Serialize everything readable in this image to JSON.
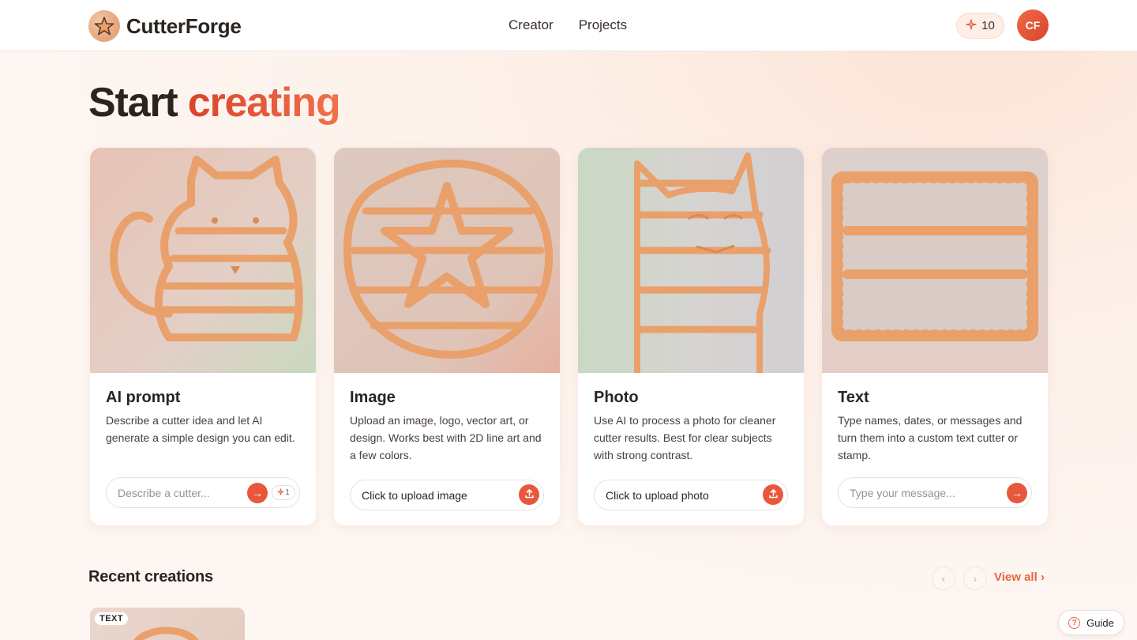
{
  "app": {
    "name": "CutterForge"
  },
  "nav": {
    "items": [
      "Creator",
      "Projects"
    ]
  },
  "header": {
    "credits": "10",
    "avatar_initials": "CF"
  },
  "hero": {
    "title_plain": "Start",
    "title_accent": "creating"
  },
  "cards": [
    {
      "title": "AI prompt",
      "description": "Describe a cutter idea and let AI generate a simple design you can edit.",
      "input_placeholder": "Describe a cutter...",
      "cost": "1",
      "image": "cat-cookie-cutter"
    },
    {
      "title": "Image",
      "description": "Upload an image, logo, vector art, or design. Works best with 2D line art and a few colors.",
      "upload_label": "Click to upload image",
      "image": "star-circle-cookie-cutter"
    },
    {
      "title": "Photo",
      "description": "Use AI to process a photo for cleaner cutter results. Best for clear subjects with strong contrast.",
      "upload_label": "Click to upload photo",
      "image": "photo-cat-cookie-cutter"
    },
    {
      "title": "Text",
      "description": "Type names, dates, or messages and turn them into a custom text cutter or stamp.",
      "input_placeholder": "Type your message...",
      "image": "text-stamp-cookie-cutter"
    }
  ],
  "recent": {
    "title": "Recent creations",
    "view_all": "View all",
    "items": [
      {
        "tag": "TEXT"
      }
    ]
  },
  "guide": {
    "label": "Guide"
  },
  "colors": {
    "accent": "#e8573b",
    "cutter": "#e9a06a",
    "background": "#fdf4ef"
  },
  "icons": [
    "star-logo-icon",
    "sparkle-icon",
    "arrow-right-icon",
    "upload-icon",
    "chevron-left-icon",
    "chevron-right-icon",
    "help-icon"
  ]
}
